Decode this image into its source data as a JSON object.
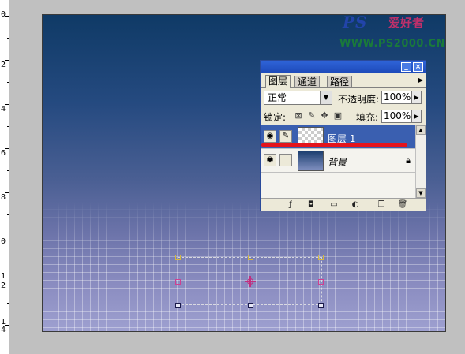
{
  "ruler": {
    "labels": [
      "0",
      "2",
      "4",
      "6",
      "8",
      "0",
      "1",
      "2",
      "1",
      "4"
    ]
  },
  "watermark": {
    "logo": "PS",
    "cn": "爱好者",
    "url": "WWW.PS2000.CN"
  },
  "panel": {
    "tabs": [
      "图层",
      "通道",
      "路径"
    ],
    "blend_mode": "正常",
    "opacity_label": "不透明度:",
    "opacity_value": "100%",
    "lock_label": "锁定:",
    "fill_label": "填充:",
    "fill_value": "100%",
    "layers": [
      {
        "name": "图层 1",
        "selected": true,
        "thumbnail": "transparent",
        "eye_icon": "eye-icon",
        "brush_icon": "brush-icon"
      },
      {
        "name": "背景",
        "selected": false,
        "thumbnail": "gradient",
        "eye_icon": "eye-icon",
        "lock_icon": "lock-icon"
      }
    ],
    "bottom_icons": [
      "link-icon",
      "layer-style-icon",
      "mask-icon",
      "group-folder-icon",
      "adjustment-layer-icon",
      "new-layer-icon",
      "trash-icon"
    ]
  },
  "colors": {
    "panel_title": "#1d49b8",
    "selected_layer": "#3a5fb0",
    "annotation": "#e4141c"
  }
}
